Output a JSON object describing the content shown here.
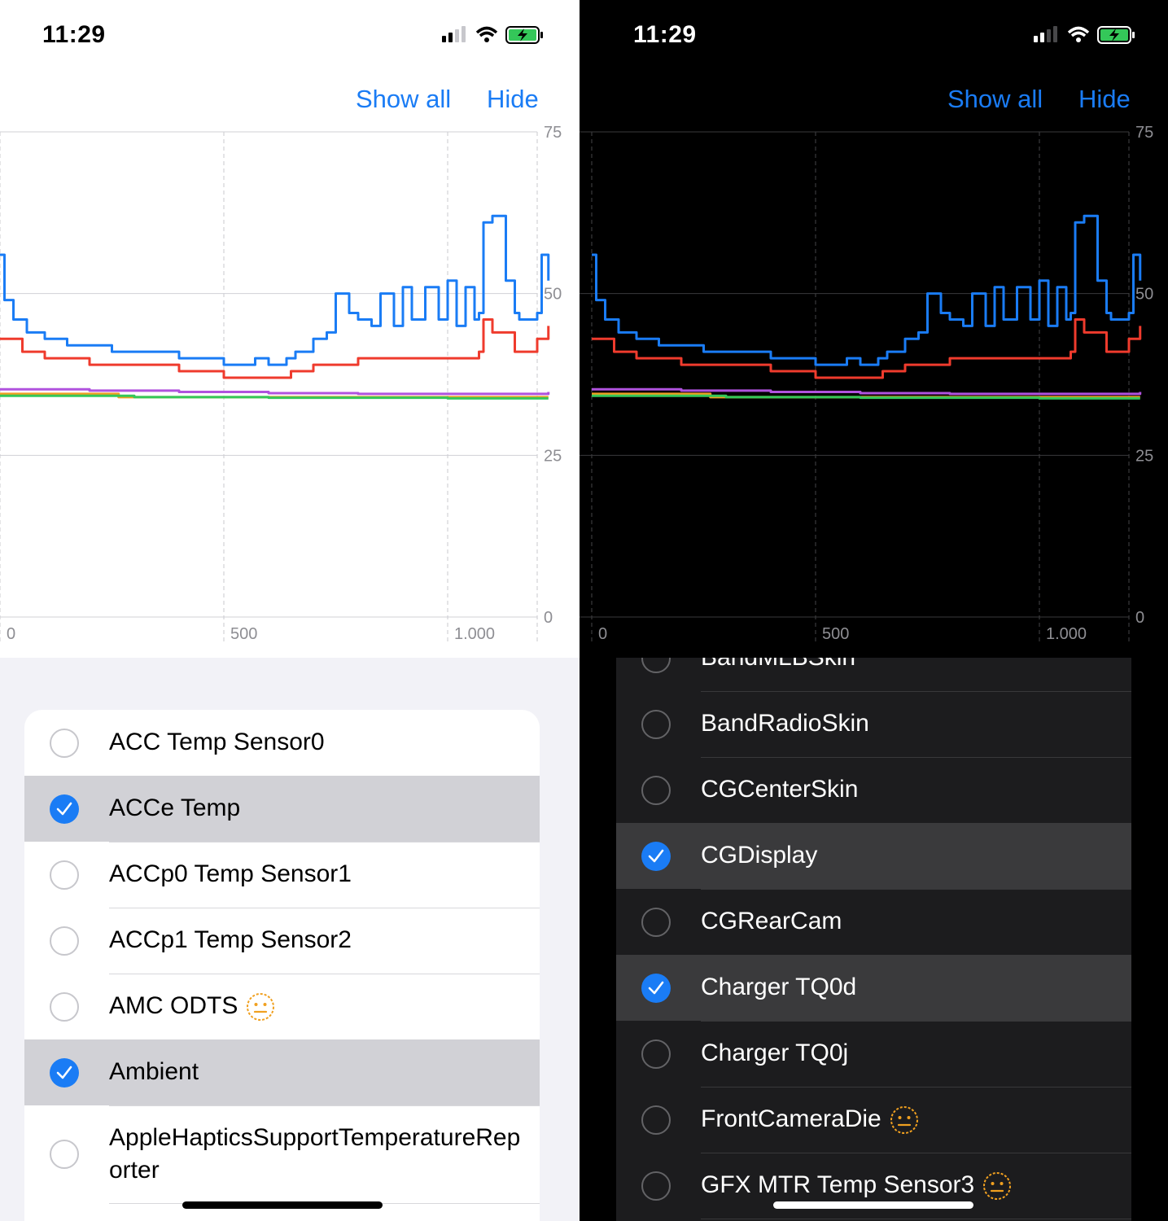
{
  "status": {
    "time": "11:29"
  },
  "toolbar": {
    "show_all": "Show all",
    "hide": "Hide"
  },
  "chart_data": {
    "type": "line",
    "title": "",
    "xlabel": "",
    "ylabel": "",
    "xlim": [
      0,
      1200
    ],
    "ylim": [
      0,
      75
    ],
    "x_ticks": [
      "0",
      "500",
      "1.000"
    ],
    "y_ticks": [
      "75",
      "50",
      "25",
      "0"
    ],
    "grid": true,
    "series": [
      {
        "color": "#1a7cf5",
        "x": [
          0,
          10,
          30,
          60,
          100,
          150,
          200,
          250,
          300,
          350,
          400,
          450,
          500,
          550,
          570,
          600,
          640,
          660,
          700,
          730,
          750,
          780,
          800,
          830,
          850,
          880,
          900,
          920,
          950,
          980,
          1000,
          1020,
          1040,
          1060,
          1070,
          1080,
          1100,
          1130,
          1150,
          1160,
          1170,
          1190,
          1200,
          1210,
          1225
        ],
        "values": [
          56,
          49,
          46,
          44,
          43,
          42,
          42,
          41,
          41,
          41,
          40,
          40,
          39,
          39,
          40,
          39,
          40,
          41,
          43,
          44,
          50,
          47,
          46,
          45,
          50,
          45,
          51,
          46,
          51,
          46,
          52,
          45,
          51,
          46,
          47,
          61,
          62,
          52,
          47,
          46,
          46,
          46,
          47,
          56,
          52
        ]
      },
      {
        "color": "#ef3b2d",
        "x": [
          0,
          50,
          100,
          200,
          300,
          400,
          500,
          600,
          650,
          700,
          800,
          900,
          1000,
          1050,
          1070,
          1080,
          1100,
          1150,
          1200,
          1225
        ],
        "values": [
          43,
          41,
          40,
          39,
          39,
          38,
          37,
          37,
          38,
          39,
          40,
          40,
          40,
          40,
          41,
          46,
          44,
          41,
          43,
          45
        ]
      },
      {
        "color": "#b052de",
        "x": [
          0,
          200,
          400,
          600,
          800,
          1000,
          1225
        ],
        "values": [
          35.2,
          35,
          34.8,
          34.6,
          34.5,
          34.5,
          34.8
        ]
      },
      {
        "color": "#f0a020",
        "x": [
          0,
          260,
          265,
          600,
          1000,
          1225
        ],
        "values": [
          34.5,
          34.5,
          34,
          34,
          34,
          34
        ]
      },
      {
        "color": "#34c759",
        "x": [
          0,
          300,
          600,
          1000,
          1225
        ],
        "values": [
          34.2,
          34,
          33.9,
          33.8,
          33.8
        ]
      }
    ]
  },
  "light_list": {
    "items": [
      {
        "label": "ACC Temp Sensor0",
        "checked": false,
        "emoji": false
      },
      {
        "label": "ACCe Temp",
        "checked": true,
        "emoji": false
      },
      {
        "label": "ACCp0 Temp Sensor1",
        "checked": false,
        "emoji": false
      },
      {
        "label": "ACCp1 Temp Sensor2",
        "checked": false,
        "emoji": false
      },
      {
        "label": "AMC ODTS",
        "checked": false,
        "emoji": true
      },
      {
        "label": "Ambient",
        "checked": true,
        "emoji": false
      },
      {
        "label": "AppleHapticsSupportTemperatureReporter",
        "checked": false,
        "emoji": false
      }
    ]
  },
  "dark_list": {
    "items": [
      {
        "label": "BandMLBSkin",
        "checked": false,
        "emoji": false
      },
      {
        "label": "BandRadioSkin",
        "checked": false,
        "emoji": false
      },
      {
        "label": "CGCenterSkin",
        "checked": false,
        "emoji": false
      },
      {
        "label": "CGDisplay",
        "checked": true,
        "emoji": false
      },
      {
        "label": "CGRearCam",
        "checked": false,
        "emoji": false
      },
      {
        "label": "Charger TQ0d",
        "checked": true,
        "emoji": false
      },
      {
        "label": "Charger TQ0j",
        "checked": false,
        "emoji": false
      },
      {
        "label": "FrontCameraDie",
        "checked": false,
        "emoji": true
      },
      {
        "label": "GFX MTR Temp Sensor3",
        "checked": false,
        "emoji": true
      }
    ]
  }
}
